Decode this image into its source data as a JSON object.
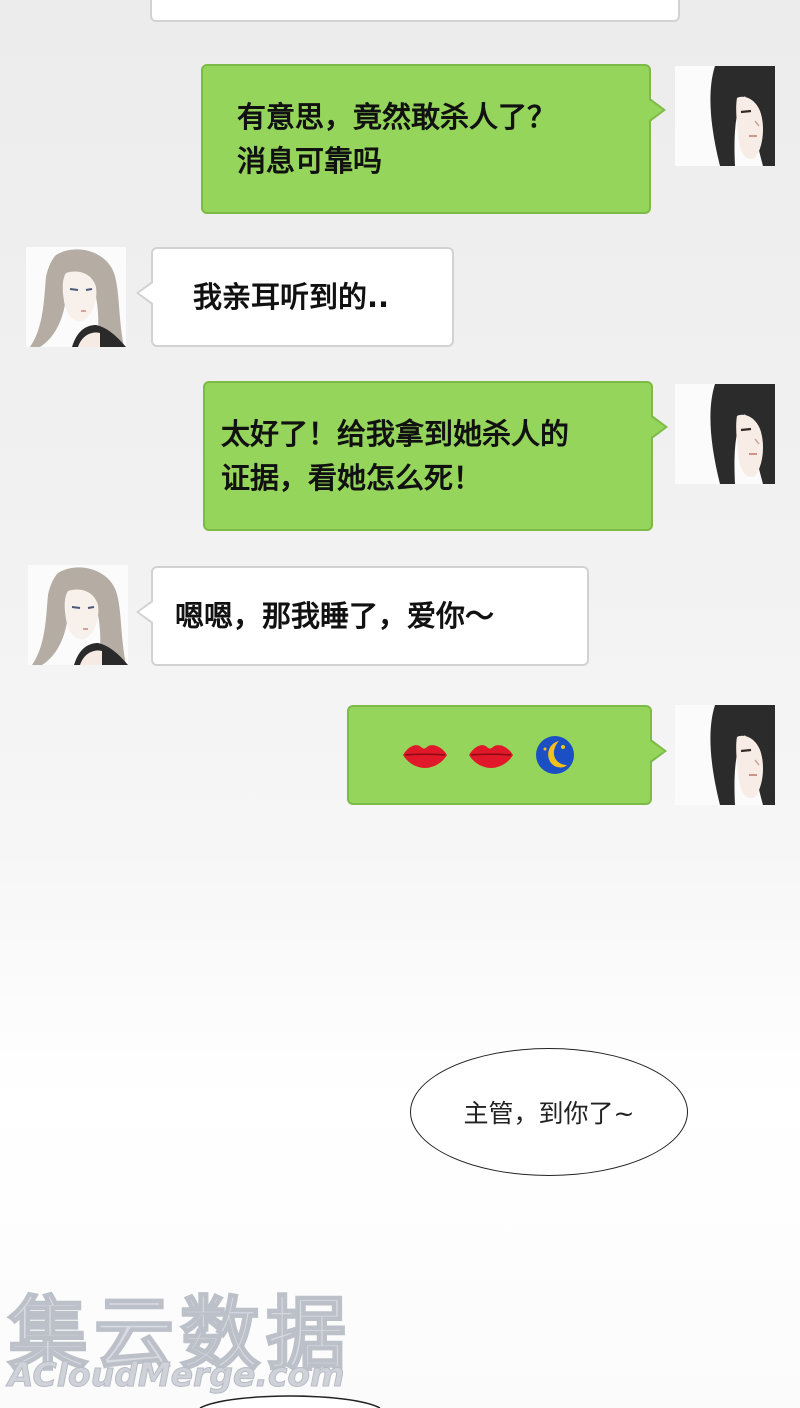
{
  "messages": [
    {
      "id": "m1",
      "side": "out",
      "text": "有意思，竟然敢杀人了？\n消息可靠吗"
    },
    {
      "id": "m2",
      "side": "in",
      "text": "我亲耳听到的.."
    },
    {
      "id": "m3",
      "side": "out",
      "text": "太好了！给我拿到她杀人的\n证据，看她怎么死！"
    },
    {
      "id": "m4",
      "side": "in",
      "text": "嗯嗯，那我睡了，爱你～"
    },
    {
      "id": "m5",
      "side": "out",
      "emojis": [
        "lips-icon",
        "lips-icon",
        "moon-icon"
      ]
    }
  ],
  "speech_bubble": {
    "text": "主管，到你了~"
  },
  "watermark": {
    "cn": "集云数据",
    "en": "ACloudMerge.com"
  },
  "colors": {
    "out_bubble": "#95d55b",
    "in_bubble": "#ffffff",
    "lips": "#e0182a",
    "moon": "#1b4fc4",
    "moon_face": "#f2c21a"
  }
}
